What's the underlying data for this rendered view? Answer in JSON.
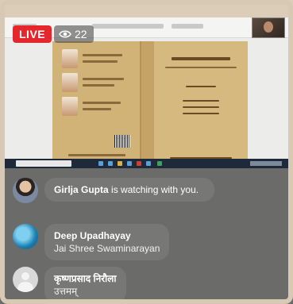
{
  "live": {
    "label": "LIVE",
    "viewer_count": "22",
    "accent_color": "#e4272d"
  },
  "comments": [
    {
      "name": "Girlja Gupta",
      "inline_text": " is watching with you.",
      "message": "",
      "avatar": "avatar-woman"
    },
    {
      "name": "Deep Upadhayay",
      "inline_text": "",
      "message": "Jai Shree Swaminarayan",
      "avatar": "avatar-globe"
    },
    {
      "name": "कृष्णप्रसाद निरौला",
      "inline_text": "",
      "message": "उत्तमम्",
      "avatar": "avatar-default"
    }
  ]
}
